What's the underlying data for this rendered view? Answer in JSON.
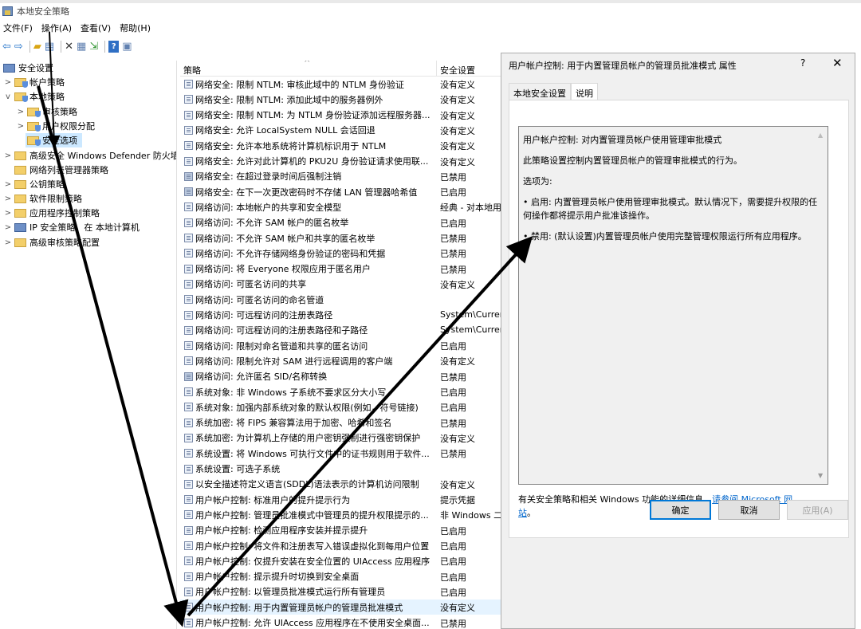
{
  "window": {
    "title": "本地安全策略"
  },
  "menu": [
    "文件(F)",
    "操作(A)",
    "查看(V)",
    "帮助(H)"
  ],
  "toolbar_icons": [
    "back-icon",
    "forward-icon",
    "up-folder-icon",
    "show-tree-icon",
    "delete-icon",
    "properties-icon",
    "export-icon",
    "help-icon",
    "console-icon"
  ],
  "tree": [
    {
      "label": "安全设置",
      "expander": "",
      "icon": "security-settings-icon"
    },
    {
      "label": "帐户策略",
      "expander": ">",
      "icon": "folder-icon"
    },
    {
      "label": "本地策略",
      "expander": "v",
      "icon": "folder-icon"
    },
    {
      "label": "审核策略",
      "expander": ">",
      "icon": "folder-icon"
    },
    {
      "label": "用户权限分配",
      "expander": ">",
      "icon": "folder-icon"
    },
    {
      "label": "安全选项",
      "expander": "",
      "icon": "folder-icon"
    },
    {
      "label": "高级安全 Windows Defender 防火墙",
      "expander": ">",
      "icon": "folder-icon"
    },
    {
      "label": "网络列表管理器策略",
      "expander": "",
      "icon": "folder-icon"
    },
    {
      "label": "公钥策略",
      "expander": ">",
      "icon": "folder-icon"
    },
    {
      "label": "软件限制策略",
      "expander": ">",
      "icon": "folder-icon"
    },
    {
      "label": "应用程序控制策略",
      "expander": ">",
      "icon": "folder-icon"
    },
    {
      "label": "IP 安全策略，在 本地计算机",
      "expander": ">",
      "icon": "computer-icon"
    },
    {
      "label": "高级审核策略配置",
      "expander": ">",
      "icon": "folder-icon"
    }
  ],
  "list": {
    "col_policy": "策略",
    "col_setting": "安全设置",
    "rows": [
      {
        "policy": "网络安全: 限制 NTLM: 审核此域中的 NTLM 身份验证",
        "setting": "没有定义"
      },
      {
        "policy": "网络安全: 限制 NTLM: 添加此域中的服务器例外",
        "setting": "没有定义"
      },
      {
        "policy": "网络安全: 限制 NTLM: 为 NTLM 身份验证添加远程服务器...",
        "setting": "没有定义"
      },
      {
        "policy": "网络安全: 允许 LocalSystem NULL 会话回退",
        "setting": "没有定义"
      },
      {
        "policy": "网络安全: 允许本地系统将计算机标识用于 NTLM",
        "setting": "没有定义"
      },
      {
        "policy": "网络安全: 允许对此计算机的 PKU2U 身份验证请求使用联...",
        "setting": "没有定义"
      },
      {
        "policy": "网络安全: 在超过登录时间后强制注销",
        "setting": "已禁用"
      },
      {
        "policy": "网络安全: 在下一次更改密码时不存储 LAN 管理器哈希值",
        "setting": "已启用"
      },
      {
        "policy": "网络访问: 本地帐户的共享和安全模型",
        "setting": "经典 - 对本地用户进行..."
      },
      {
        "policy": "网络访问: 不允许 SAM 帐户的匿名枚举",
        "setting": "已启用"
      },
      {
        "policy": "网络访问: 不允许 SAM 帐户和共享的匿名枚举",
        "setting": "已禁用"
      },
      {
        "policy": "网络访问: 不允许存储网络身份验证的密码和凭据",
        "setting": "已禁用"
      },
      {
        "policy": "网络访问: 将 Everyone 权限应用于匿名用户",
        "setting": "已禁用"
      },
      {
        "policy": "网络访问: 可匿名访问的共享",
        "setting": "没有定义"
      },
      {
        "policy": "网络访问: 可匿名访问的命名管道",
        "setting": ""
      },
      {
        "policy": "网络访问: 可远程访问的注册表路径",
        "setting": "System\\CurrentControlSet\\..."
      },
      {
        "policy": "网络访问: 可远程访问的注册表路径和子路径",
        "setting": "System\\CurrentControlSet\\..."
      },
      {
        "policy": "网络访问: 限制对命名管道和共享的匿名访问",
        "setting": "已启用"
      },
      {
        "policy": "网络访问: 限制允许对 SAM 进行远程调用的客户端",
        "setting": "没有定义"
      },
      {
        "policy": "网络访问: 允许匿名 SID/名称转换",
        "setting": "已禁用"
      },
      {
        "policy": "系统对象: 非 Windows 子系统不要求区分大小写",
        "setting": "已启用"
      },
      {
        "policy": "系统对象: 加强内部系统对象的默认权限(例如，符号链接)",
        "setting": "已启用"
      },
      {
        "policy": "系统加密: 将 FIPS 兼容算法用于加密、哈希和签名",
        "setting": "已禁用"
      },
      {
        "policy": "系统加密: 为计算机上存储的用户密钥强制进行强密钥保护",
        "setting": "没有定义"
      },
      {
        "policy": "系统设置: 将 Windows 可执行文件中的证书规则用于软件...",
        "setting": "已禁用"
      },
      {
        "policy": "系统设置: 可选子系统",
        "setting": ""
      },
      {
        "policy": "以安全描述符定义语言(SDDL)语法表示的计算机访问限制",
        "setting": "没有定义"
      },
      {
        "policy": "用户帐户控制: 标准用户的提升提示行为",
        "setting": "提示凭据"
      },
      {
        "policy": "用户帐户控制: 管理员批准模式中管理员的提升权限提示的...",
        "setting": "非 Windows 二进制文件..."
      },
      {
        "policy": "用户帐户控制: 检测应用程序安装并提示提升",
        "setting": "已启用"
      },
      {
        "policy": "用户帐户控制: 将文件和注册表写入错误虚拟化到每用户位置",
        "setting": "已启用"
      },
      {
        "policy": "用户帐户控制: 仅提升安装在安全位置的 UIAccess 应用程序",
        "setting": "已启用"
      },
      {
        "policy": "用户帐户控制: 提示提升时切换到安全桌面",
        "setting": "已启用"
      },
      {
        "policy": "用户帐户控制: 以管理员批准模式运行所有管理员",
        "setting": "已启用"
      },
      {
        "policy": "用户帐户控制: 用于内置管理员帐户的管理员批准模式",
        "setting": "没有定义"
      },
      {
        "policy": "用户帐户控制: 允许 UIAccess 应用程序在不使用安全桌面...",
        "setting": "已禁用"
      }
    ]
  },
  "dialog": {
    "title": "用户帐户控制: 用于内置管理员帐户的管理员批准模式 属性",
    "help": "?",
    "close": "✕",
    "tabs": [
      "本地安全设置",
      "说明"
    ],
    "paragraphs": [
      "用户帐户控制: 对内置管理员帐户使用管理审批模式",
      "此策略设置控制内置管理员帐户的管理审批模式的行为。",
      "选项为:",
      "• 启用: 内置管理员帐户使用管理审批模式。默认情况下，需要提升权限的任何操作都将提示用户批准该操作。",
      "• 禁用: (默认设置)内置管理员帐户使用完整管理权限运行所有应用程序。"
    ],
    "more_text": "有关安全策略和相关 Windows 功能的详细信息，",
    "more_link": "请参阅 Microsoft 网站",
    "more_end": "。",
    "ok": "确定",
    "cancel": "取消",
    "apply": "应用(A)"
  }
}
